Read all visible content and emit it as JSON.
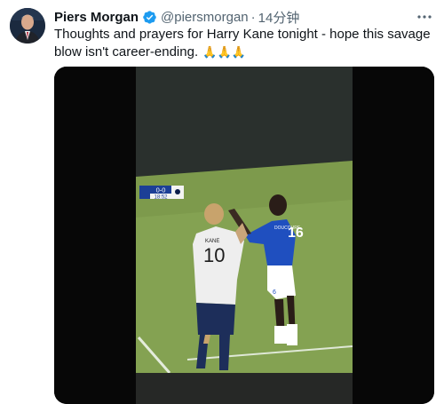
{
  "tweet": {
    "author_name": "Piers Morgan",
    "handle": "@piersmorgan",
    "separator": "·",
    "time": "14分钟",
    "text": "Thoughts and prayers for Harry Kane tonight - hope this savage blow isn't career-ending.",
    "emojis": "🙏🙏🙏",
    "verified": true,
    "more_icon": "more-dots-icon"
  },
  "video": {
    "scoreboard": {
      "score": "0-0",
      "clock": "18:52"
    },
    "players": {
      "white_name": "KANE",
      "white_number": "10",
      "blue_name": "DOUCOURE",
      "blue_number": "16",
      "blue_shorts_number": "6"
    }
  },
  "colors": {
    "verified_blue": "#1d9bf0",
    "text": "#0f1419",
    "secondary": "#536471"
  }
}
